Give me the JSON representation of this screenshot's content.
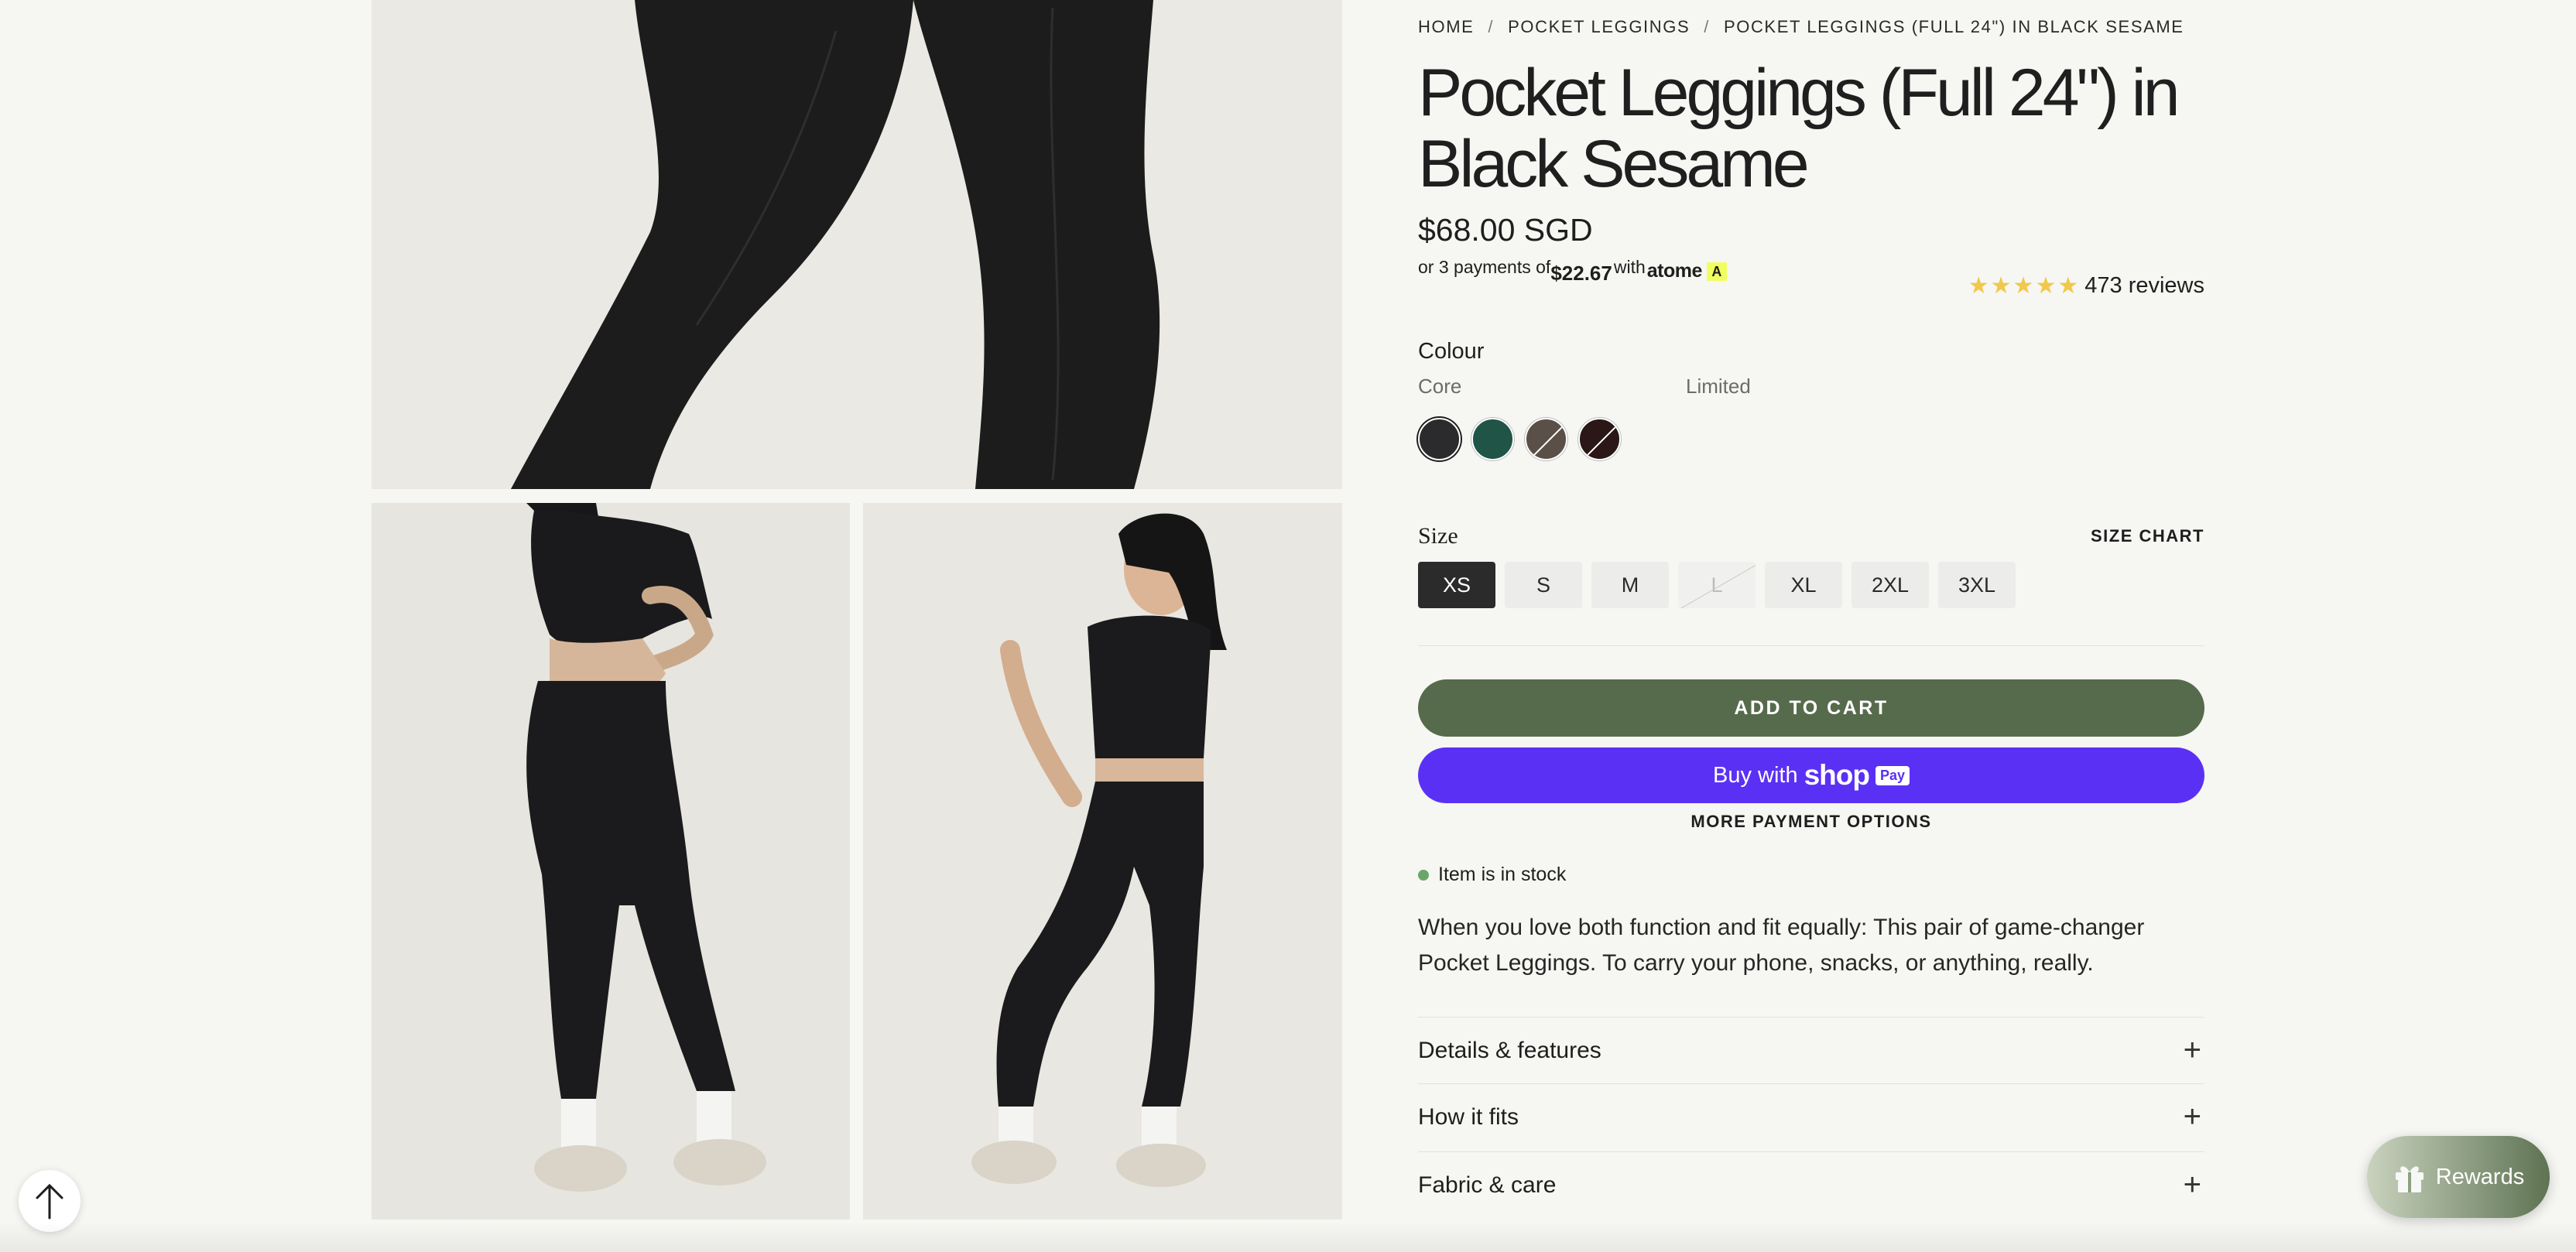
{
  "breadcrumb": {
    "home": "HOME",
    "collection": "POCKET LEGGINGS",
    "current": "POCKET LEGGINGS (FULL 24\") IN BLACK SESAME",
    "separator": "/"
  },
  "product": {
    "title": "Pocket Leggings (Full 24\") in Black Sesame",
    "price": "$68.00 SGD",
    "description": "When you love both function and fit equally: This pair of game-changer Pocket Leggings. To carry your phone, snacks, or anything, really."
  },
  "installments": {
    "prefix": "or 3 payments of",
    "amount": "$22.67",
    "with": "with",
    "provider": "atome",
    "provider_badge": "A"
  },
  "rating": {
    "stars": "★★★★★",
    "value": 5,
    "reviews": "473 reviews"
  },
  "colour": {
    "label": "Colour",
    "groups": [
      "Core",
      "Limited"
    ],
    "swatches": [
      {
        "name": "Black Sesame",
        "color": "#2b2b2e",
        "selected": true,
        "available": true
      },
      {
        "name": "Forest Green",
        "color": "#1f5446",
        "selected": false,
        "available": true
      },
      {
        "name": "Taupe",
        "color": "#5a5048",
        "selected": false,
        "available": false
      },
      {
        "name": "Espresso",
        "color": "#2a1716",
        "selected": false,
        "available": false
      }
    ]
  },
  "size": {
    "label": "Size",
    "chart_link": "SIZE CHART",
    "options": [
      {
        "label": "XS",
        "selected": true,
        "available": true
      },
      {
        "label": "S",
        "selected": false,
        "available": true
      },
      {
        "label": "M",
        "selected": false,
        "available": true
      },
      {
        "label": "L",
        "selected": false,
        "available": false
      },
      {
        "label": "XL",
        "selected": false,
        "available": true
      },
      {
        "label": "2XL",
        "selected": false,
        "available": true
      },
      {
        "label": "3XL",
        "selected": false,
        "available": true
      }
    ]
  },
  "actions": {
    "add_to_cart": "ADD TO CART",
    "buy_with": "Buy with",
    "shop_word": "shop",
    "pay_badge": "Pay",
    "more_payment": "MORE PAYMENT OPTIONS"
  },
  "stock": {
    "text": "Item is in stock",
    "color": "#6aa66a"
  },
  "accordions": [
    {
      "label": "Details & features",
      "icon": "plus-icon"
    },
    {
      "label": "How it fits",
      "icon": "plus-icon"
    },
    {
      "label": "Fabric & care",
      "icon": "plus-icon"
    }
  ],
  "widgets": {
    "rewards_label": "Rewards",
    "rewards_icon": "gift-icon",
    "back_to_top_icon": "arrow-up-icon"
  },
  "colors": {
    "accent_cart": "#566b4b",
    "shop_pay": "#5a31f4",
    "star": "#f2c84b"
  }
}
